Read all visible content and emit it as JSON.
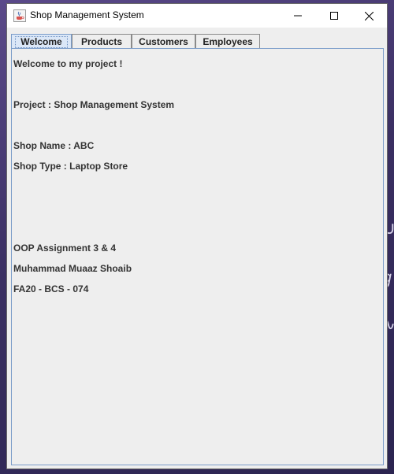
{
  "window": {
    "title": "Shop Management System",
    "icon": "java-cup-icon"
  },
  "title_buttons": {
    "minimize_icon": "minimize-icon",
    "maximize_icon": "maximize-icon",
    "close_icon": "close-icon"
  },
  "tabs": [
    {
      "label": "Welcome",
      "selected": true
    },
    {
      "label": "Products",
      "selected": false
    },
    {
      "label": "Customers",
      "selected": false
    },
    {
      "label": "Employees",
      "selected": false
    }
  ],
  "welcome": {
    "greeting": "Welcome to my project !",
    "project": "Project : Shop Management System",
    "shop_name": "Shop Name : ABC",
    "shop_type": "Shop Type : Laptop Store",
    "assignment": "OOP Assignment 3 & 4",
    "author": "Muhammad Muaaz Shoaib",
    "roll_no": "FA20 - BCS - 074"
  },
  "colors": {
    "active_tab": "#dbe7f7",
    "panel_border": "#7a9cc9",
    "window_bg": "#eeeeee"
  }
}
